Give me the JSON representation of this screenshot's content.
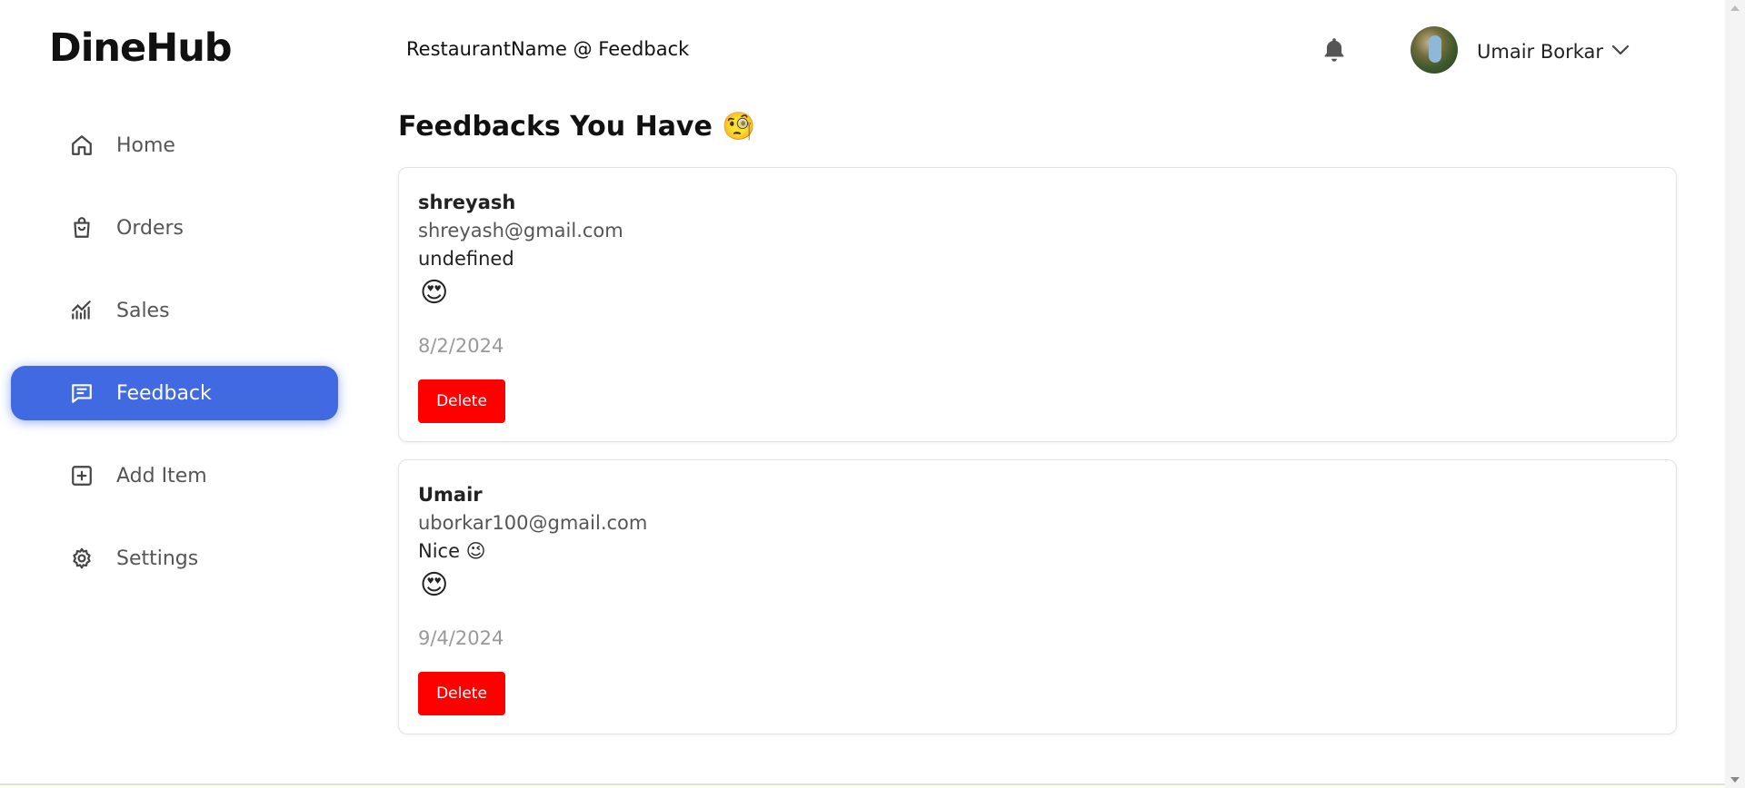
{
  "app": {
    "logo": "DineHub"
  },
  "header": {
    "title": "RestaurantName @ Feedback",
    "user_name": "Umair Borkar"
  },
  "sidebar": {
    "items": [
      {
        "label": "Home",
        "icon": "home-icon",
        "active": false
      },
      {
        "label": "Orders",
        "icon": "shopping-bag-icon",
        "active": false
      },
      {
        "label": "Sales",
        "icon": "chart-icon",
        "active": false
      },
      {
        "label": "Feedback",
        "icon": "message-icon",
        "active": true
      },
      {
        "label": "Add Item",
        "icon": "plus-square-icon",
        "active": false
      },
      {
        "label": "Settings",
        "icon": "gear-icon",
        "active": false
      }
    ]
  },
  "main": {
    "title": "Feedbacks You Have 🧐",
    "feedbacks": [
      {
        "name": "shreyash",
        "email": "shreyash@gmail.com",
        "message": "undefined",
        "rating": "😍",
        "date": "8/2/2024",
        "delete_label": "Delete"
      },
      {
        "name": "Umair",
        "email": "uborkar100@gmail.com",
        "message": "Nice 😉",
        "rating": "😍",
        "date": "9/4/2024",
        "delete_label": "Delete"
      }
    ]
  },
  "colors": {
    "accent": "#4169e1",
    "delete": "#ff0000"
  }
}
